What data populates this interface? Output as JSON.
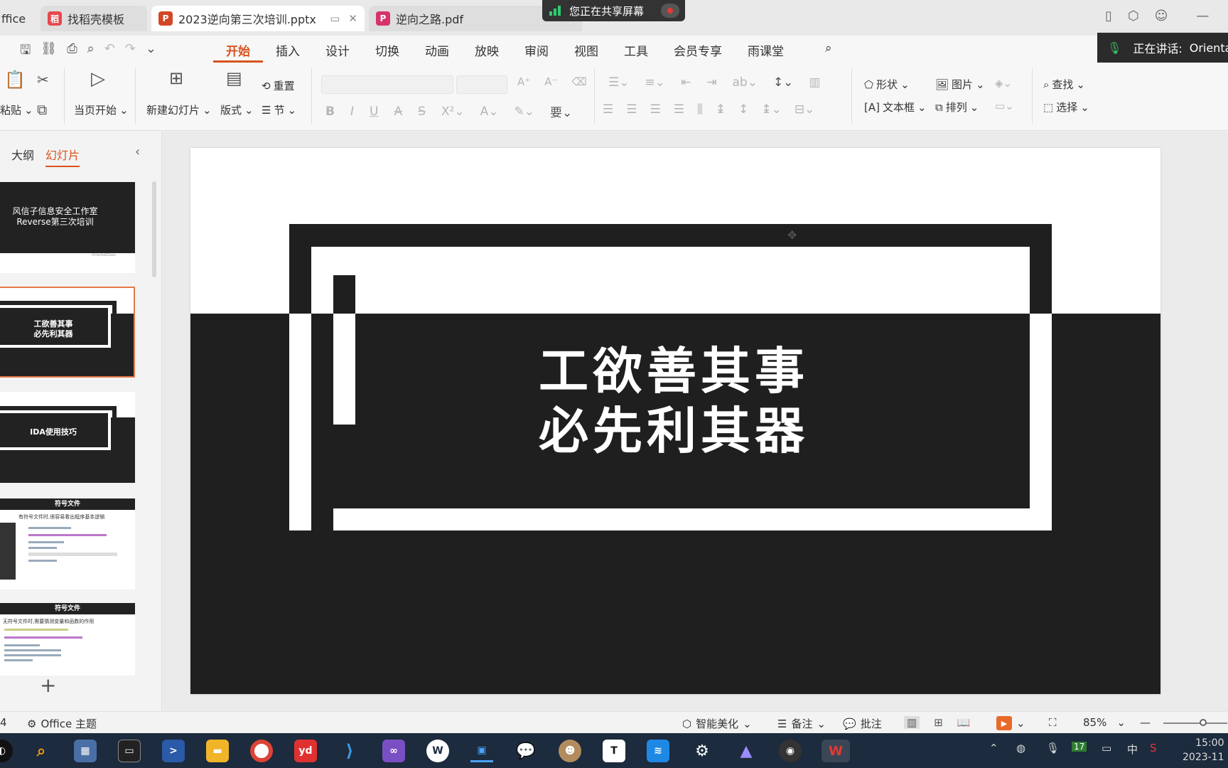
{
  "tabs": [
    {
      "label": "ffice"
    },
    {
      "label": "找稻壳模板"
    },
    {
      "label": "2023逆向第三次培训.pptx"
    },
    {
      "label": "逆向之路.pdf"
    }
  ],
  "share_banner": {
    "label": "您正在共享屏幕"
  },
  "menu": [
    "开始",
    "插入",
    "设计",
    "切换",
    "动画",
    "放映",
    "审阅",
    "视图",
    "工具",
    "会员专享",
    "雨课堂"
  ],
  "speaking": {
    "label": "正在讲话:",
    "name": "Orienta"
  },
  "ribbon": {
    "paste": "粘贴",
    "from_current": "当页开始",
    "new_slide": "新建幻灯片",
    "layout": "版式",
    "reset": "重置",
    "section": "节",
    "shape": "形状",
    "picture": "图片",
    "textbox": "文本框",
    "arrange": "排列",
    "find": "查找",
    "select": "选择"
  },
  "pane": {
    "outline": "大纲",
    "slides": "幻灯片"
  },
  "thumbnails": [
    {
      "line1": "风信子信息安全工作室",
      "line2": "Reverse第三次培训",
      "footer": "- OrientalGlass"
    },
    {
      "line1": "工欲善其事",
      "line2": "必先利其器"
    },
    {
      "line1": "IDA使用技巧"
    },
    {
      "header": "符号文件",
      "caption": "有符号文件时,很容易看出程序基本逻辑"
    },
    {
      "header": "符号文件",
      "caption": "无符号文件时,需要猜测变量和函数的作用"
    }
  ],
  "slide": {
    "title_line1": "工欲善其事",
    "title_line2": "必先利其器"
  },
  "status": {
    "slide_num": "4",
    "theme": "Office 主题",
    "beautify": "智能美化",
    "notes": "备注",
    "comments": "批注",
    "zoom": "85%"
  },
  "taskbar": {
    "time": "15:00",
    "date": "2023-11",
    "ime": "中",
    "badge": "17"
  },
  "colors": {
    "accent": "#d9531e",
    "slide_dark": "#1f1f20",
    "taskbar": "#1c2b3d"
  }
}
